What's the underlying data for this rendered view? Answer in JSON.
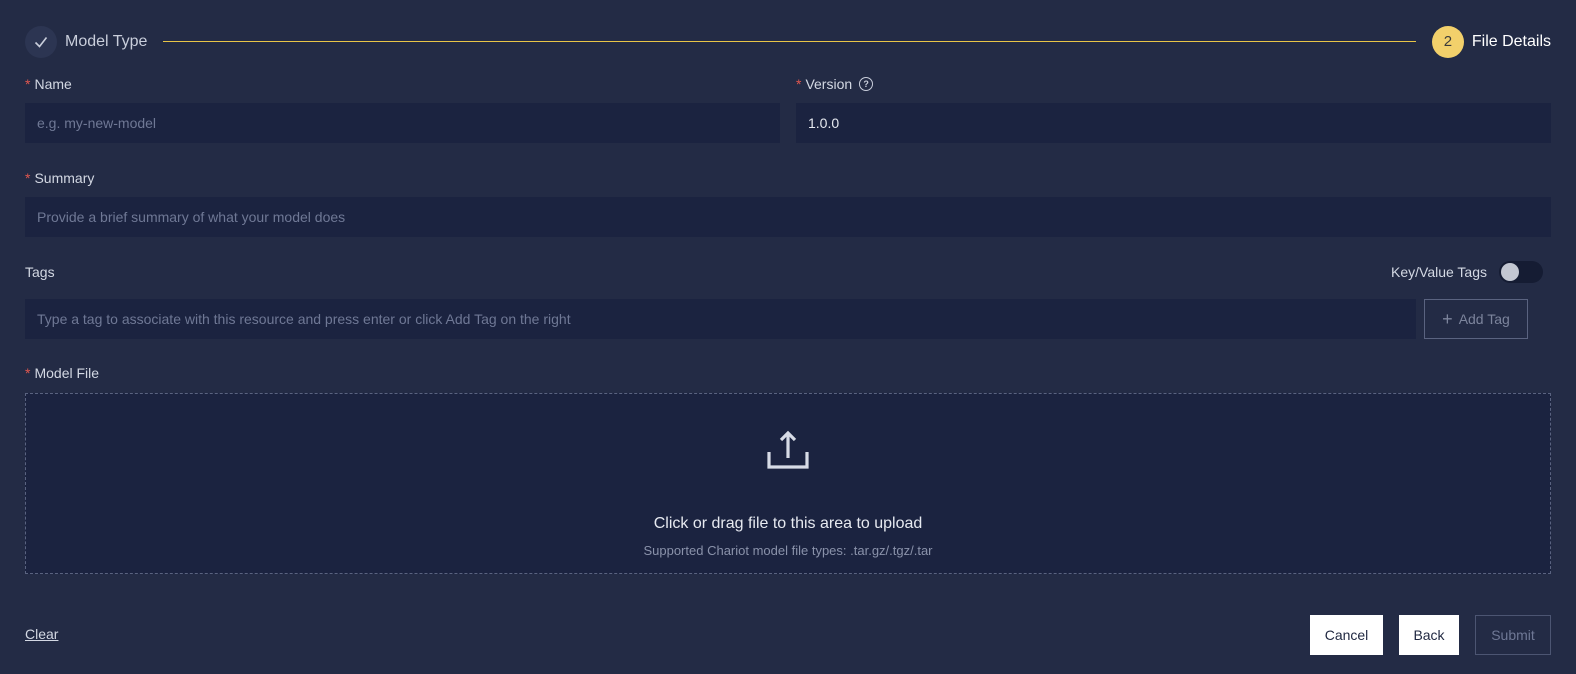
{
  "steps": {
    "step1": {
      "label": "Model Type",
      "icon": "check-icon"
    },
    "step2": {
      "number": "2",
      "label": "File Details"
    },
    "line_color": "#e8c547",
    "active_color": "#f2d06b"
  },
  "form": {
    "name": {
      "label": "Name",
      "required": "*",
      "placeholder": "e.g. my-new-model",
      "value": ""
    },
    "version": {
      "label": "Version",
      "required": "*",
      "value": "1.0.0",
      "help_icon": "question-circle-icon"
    },
    "summary": {
      "label": "Summary",
      "required": "*",
      "placeholder": "Provide a brief summary of what your model does",
      "value": ""
    },
    "tags": {
      "label": "Tags",
      "placeholder": "Type a tag to associate with this resource and press enter or click Add Tag on the right",
      "add_button": "Add Tag",
      "kv_toggle_label": "Key/Value Tags",
      "kv_toggle_on": false
    },
    "model_file": {
      "label": "Model File",
      "required": "*",
      "drop_text": "Click or drag file to this area to upload",
      "drop_hint": "Supported Chariot model file types: .tar.gz/.tgz/.tar",
      "icon": "upload-icon"
    }
  },
  "footer": {
    "clear": "Clear",
    "cancel": "Cancel",
    "back": "Back",
    "submit": "Submit"
  },
  "colors": {
    "background": "#232b45",
    "input_bg": "#1b2340",
    "required": "#e0574f"
  }
}
